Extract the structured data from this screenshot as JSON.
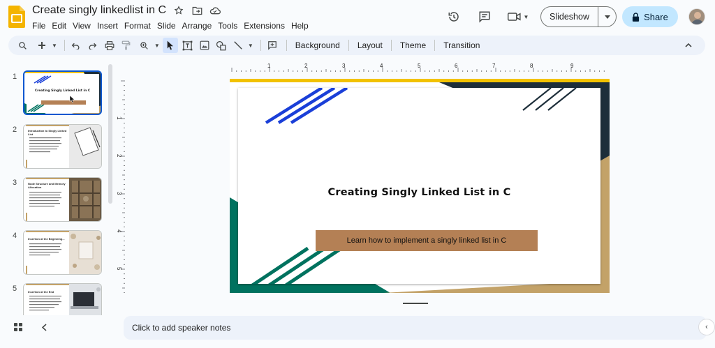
{
  "app": {
    "doc_title": "Create singly linkedlist in C"
  },
  "menu": [
    "File",
    "Edit",
    "View",
    "Insert",
    "Format",
    "Slide",
    "Arrange",
    "Tools",
    "Extensions",
    "Help"
  ],
  "header": {
    "slideshow_label": "Slideshow",
    "share_label": "Share"
  },
  "toolbar": {
    "background_label": "Background",
    "layout_label": "Layout",
    "theme_label": "Theme",
    "transition_label": "Transition"
  },
  "filmstrip": [
    {
      "num": "1",
      "title": "Creating Singly Linked List in C"
    },
    {
      "num": "2",
      "title": "Introduction to Singly Linked List"
    },
    {
      "num": "3",
      "title": "Node Structure and Memory Allocation"
    },
    {
      "num": "4",
      "title": "Insertion at the Beginning..."
    },
    {
      "num": "5",
      "title": "Insertion at the End"
    }
  ],
  "ruler": {
    "top_numbers": [
      "1",
      "2",
      "3",
      "4",
      "5",
      "6",
      "7",
      "8",
      "9"
    ],
    "left_numbers": [
      "1",
      "2",
      "3",
      "4",
      "5"
    ]
  },
  "slide": {
    "title": "Creating Singly Linked List in C",
    "subtitle": "Learn how to implement a singly linked list in C"
  },
  "notes": {
    "placeholder": "Click to add speaker notes"
  },
  "colors": {
    "accent_blue": "#0b57d0",
    "share_bg": "#c2e7ff",
    "stripe_blue": "#1a3fd8",
    "teal": "#00725f",
    "tan": "#c3a268",
    "dark_navy": "#1d2e3a",
    "yellow": "#f2c200",
    "subtitle_bg": "#b48055"
  }
}
